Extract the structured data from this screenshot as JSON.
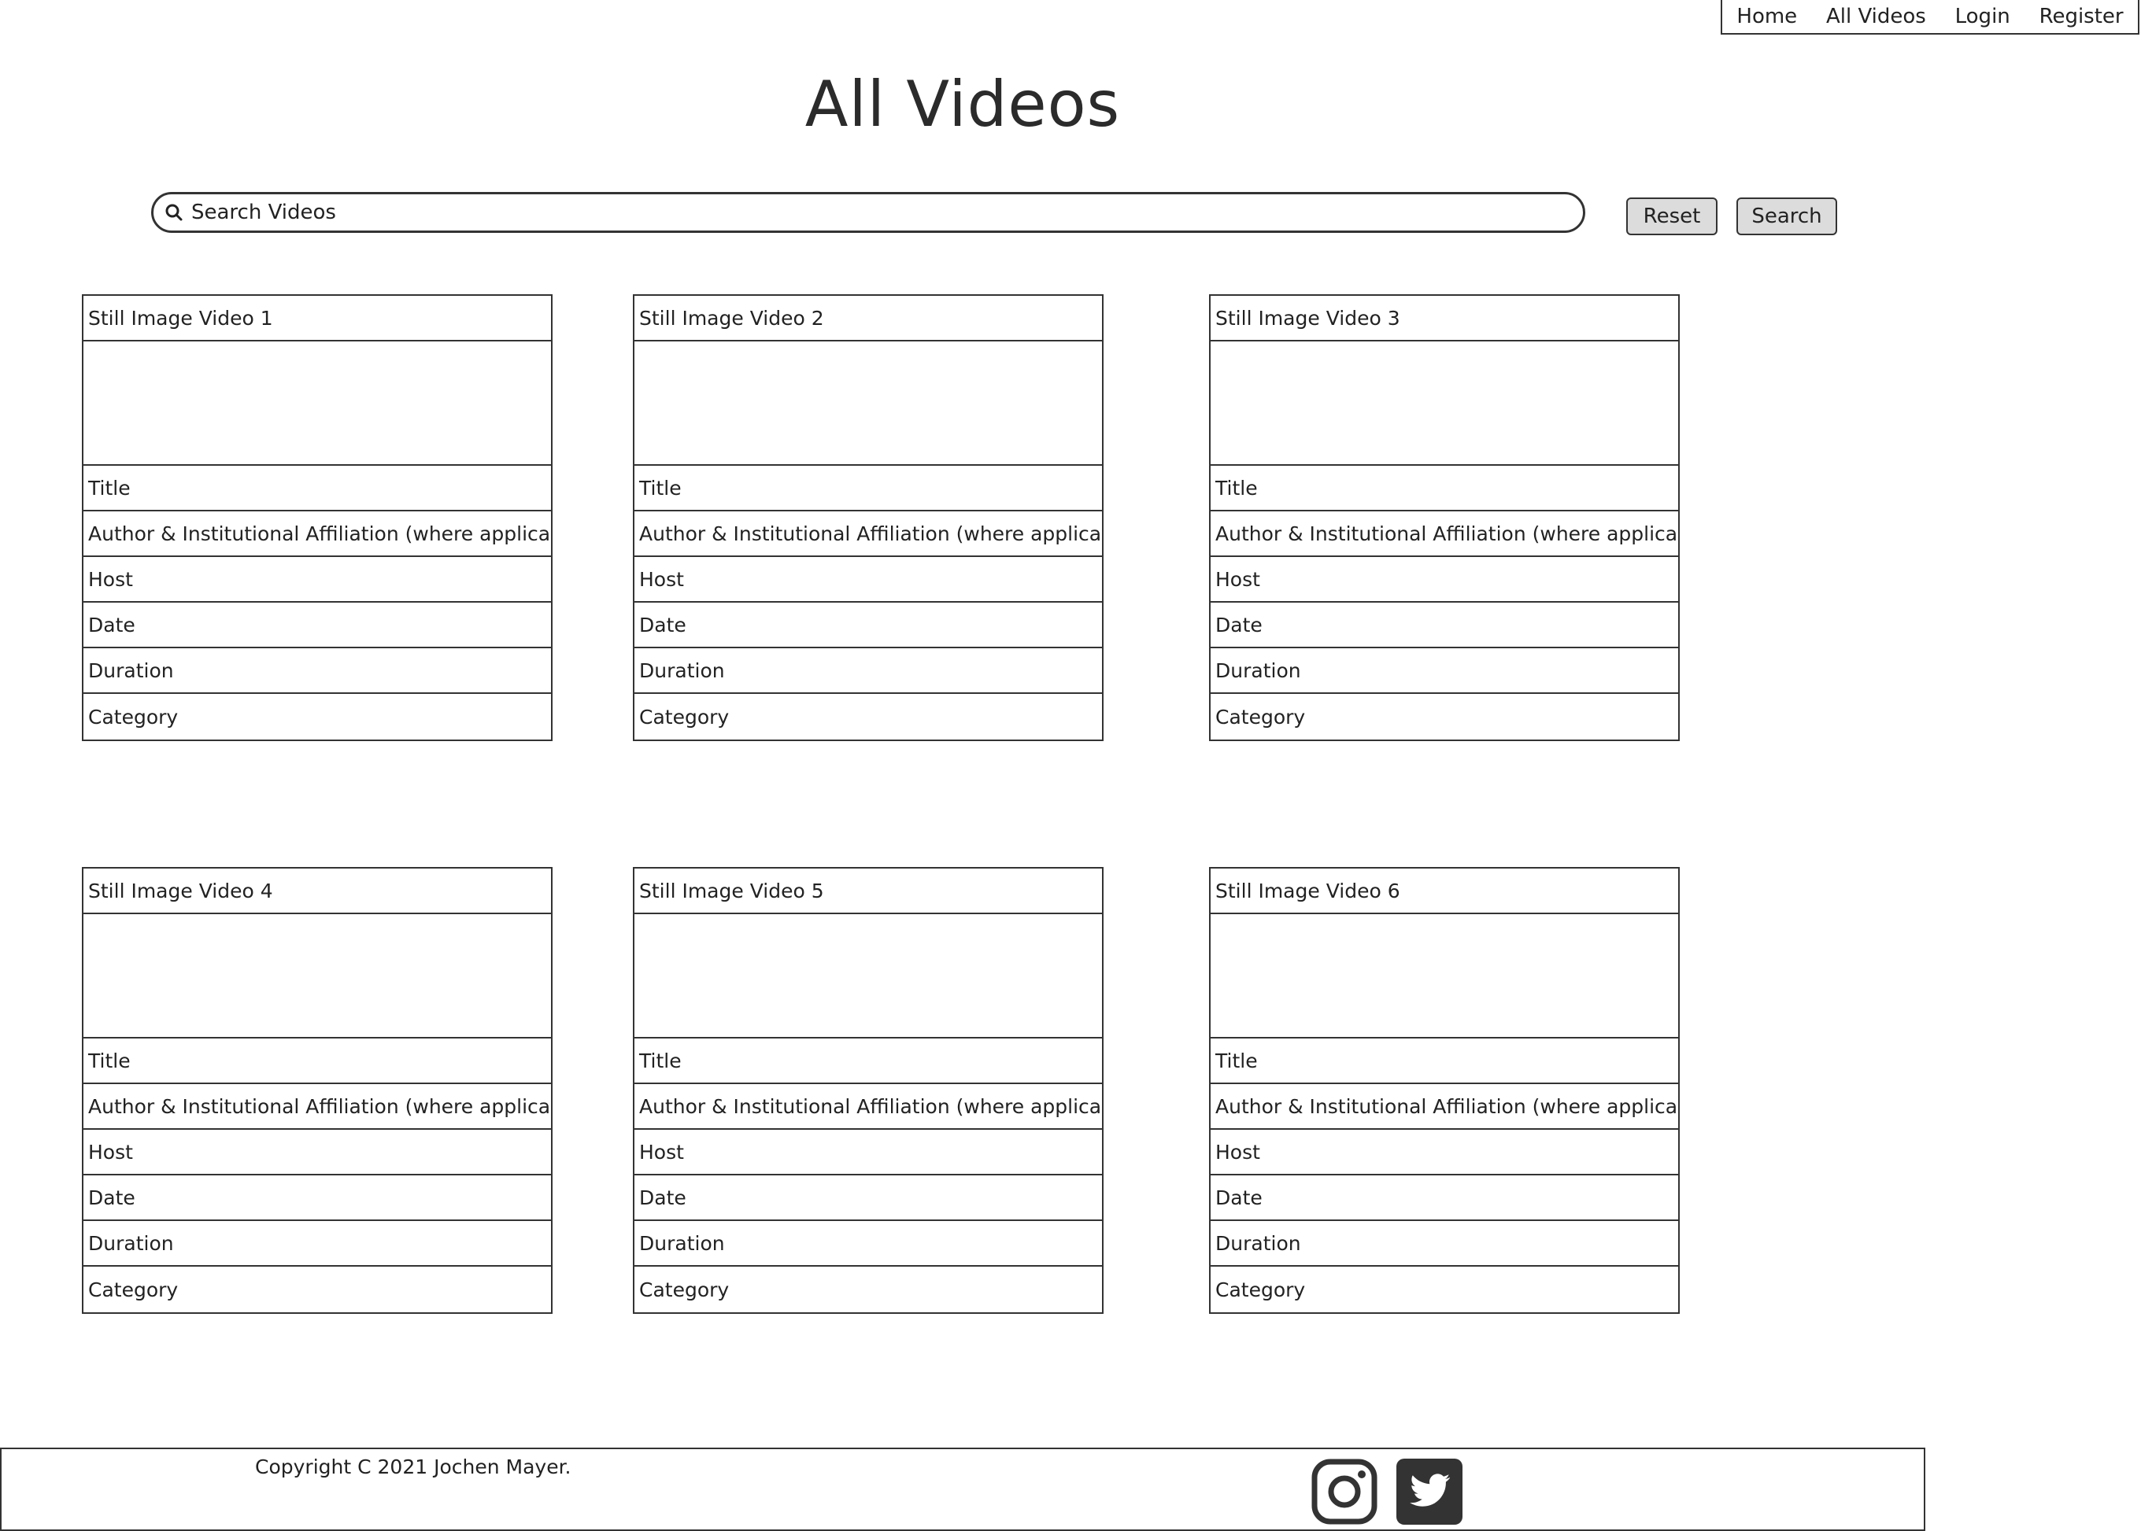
{
  "nav": {
    "items": [
      "Home",
      "All Videos",
      "Login",
      "Register"
    ]
  },
  "page_title": "All Videos",
  "search": {
    "placeholder": "Search Videos",
    "reset_label": "Reset",
    "search_label": "Search"
  },
  "videos": [
    {
      "still": "Still Image Video 1",
      "title": "Title",
      "author": "Author & Institutional Affiliation (where applicable)",
      "host": "Host",
      "date": "Date",
      "duration": "Duration",
      "category": "Category"
    },
    {
      "still": "Still Image Video 2",
      "title": "Title",
      "author": "Author & Institutional Affiliation (where applicable)",
      "host": "Host",
      "date": "Date",
      "duration": "Duration",
      "category": "Category"
    },
    {
      "still": "Still Image Video 3",
      "title": "Title",
      "author": "Author & Institutional Affiliation (where applicable)",
      "host": "Host",
      "date": "Date",
      "duration": "Duration",
      "category": "Category"
    },
    {
      "still": "Still Image Video 4",
      "title": "Title",
      "author": "Author & Institutional Affiliation (where applicable)",
      "host": "Host",
      "date": "Date",
      "duration": "Duration",
      "category": "Category"
    },
    {
      "still": "Still Image Video 5",
      "title": "Title",
      "author": "Author & Institutional Affiliation (where applicable)",
      "host": "Host",
      "date": "Date",
      "duration": "Duration",
      "category": "Category"
    },
    {
      "still": "Still Image Video 6",
      "title": "Title",
      "author": "Author & Institutional Affiliation (where applicable)",
      "host": "Host",
      "date": "Date",
      "duration": "Duration",
      "category": "Category"
    }
  ],
  "footer": {
    "copyright": "Copyright C 2021 Jochen Mayer.",
    "social_icons": [
      "instagram-icon",
      "twitter-icon"
    ]
  }
}
